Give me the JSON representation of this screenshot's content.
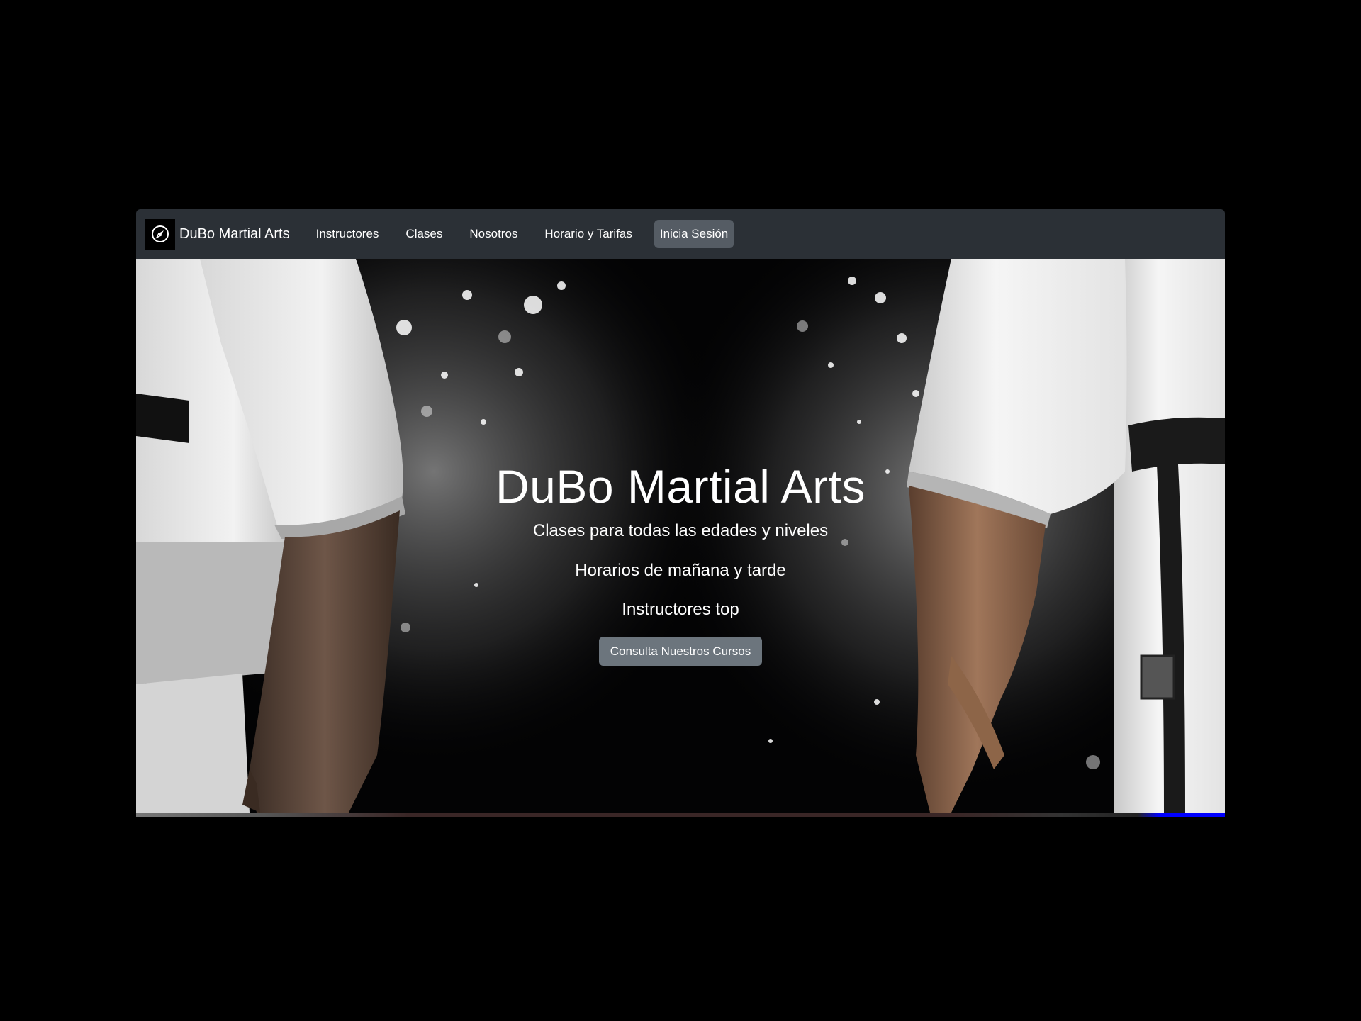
{
  "navbar": {
    "brand": "DuBo Martial Arts",
    "links": [
      "Instructores",
      "Clases",
      "Nosotros",
      "Horario y Tarifas"
    ],
    "login": "Inicia Sesión"
  },
  "hero": {
    "title": "DuBo Martial Arts",
    "lines": [
      "Clases para todas las edades y niveles",
      "Horarios de mañana y tarde",
      "Instructores top"
    ],
    "button": "Consulta Nuestros Cursos"
  },
  "colors": {
    "navbar_bg": "#2b3036",
    "button_bg": "#6c757d",
    "login_bg": "#555c64"
  }
}
